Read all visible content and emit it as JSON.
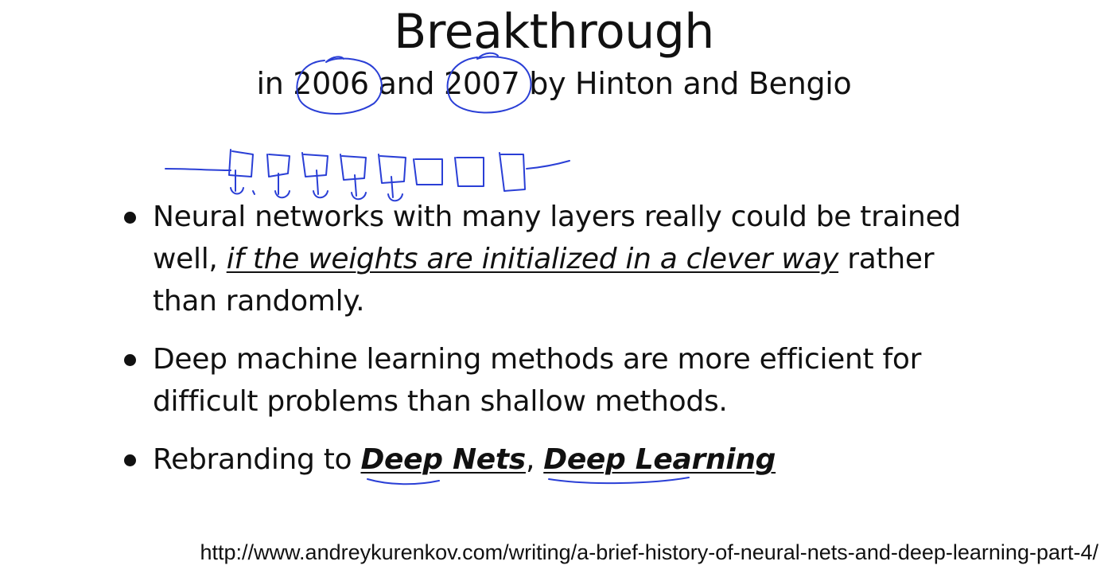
{
  "slide": {
    "title": "Breakthrough",
    "subtitle": {
      "prefix": "in ",
      "year1": "2006",
      "middle": " and ",
      "year2": "2007",
      "suffix": " by Hinton and Bengio"
    },
    "bullets": [
      {
        "before": "Neural networks with many layers really could be trained well, ",
        "emphasis": "if the weights are initialized in a clever way",
        "after": " rather than randomly."
      },
      {
        "text": "Deep machine learning methods are more efficient for difficult problems than shallow methods."
      },
      {
        "before": "Rebranding to ",
        "term1": "Deep Nets",
        "separator": ", ",
        "term2": "Deep Learning"
      }
    ],
    "source_url": "http://www.andreykurenkov.com/writing/a-brief-history-of-neural-nets-and-deep-learning-part-4/"
  },
  "annotations": {
    "ink_color": "#2a3fd6"
  }
}
